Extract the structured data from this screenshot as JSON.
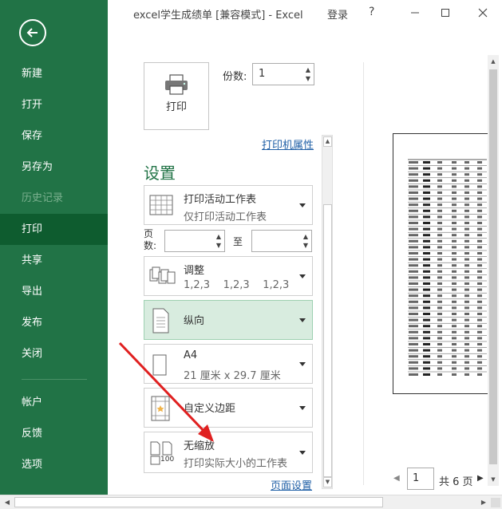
{
  "window": {
    "title": "excel学生成绩单  [兼容模式]  -  Excel",
    "login": "登录",
    "help": "?"
  },
  "sidebar": {
    "items": [
      {
        "label": "新建"
      },
      {
        "label": "打开"
      },
      {
        "label": "保存"
      },
      {
        "label": "另存为"
      },
      {
        "label": "历史记录"
      },
      {
        "label": "打印"
      },
      {
        "label": "共享"
      },
      {
        "label": "导出"
      },
      {
        "label": "发布"
      },
      {
        "label": "关闭"
      },
      {
        "label": "帐户"
      },
      {
        "label": "反馈"
      },
      {
        "label": "选项"
      }
    ],
    "active": "打印",
    "disabled": "历史记录"
  },
  "print": {
    "button_label": "打印",
    "copies_label": "份数:",
    "copies_value": "1",
    "printer_properties": "打印机属性"
  },
  "settings": {
    "title": "设置",
    "what_to_print": {
      "main": "打印活动工作表",
      "sub": "仅打印活动工作表"
    },
    "pages_label": "页数:",
    "pages_to": "至",
    "collate": {
      "main": "调整",
      "sub": "1,2,3    1,2,3    1,2,3"
    },
    "orientation": {
      "main": "纵向"
    },
    "paper": {
      "main": "A4",
      "sub": "21 厘米 x 29.7 厘米"
    },
    "margins": {
      "main": "自定义边距"
    },
    "scaling": {
      "main": "无缩放",
      "sub": "打印实际大小的工作表"
    },
    "page_setup": "页面设置",
    "scaling_icon_text": "100"
  },
  "preview": {
    "current_page": "1",
    "total_pages": "共 6 页"
  }
}
